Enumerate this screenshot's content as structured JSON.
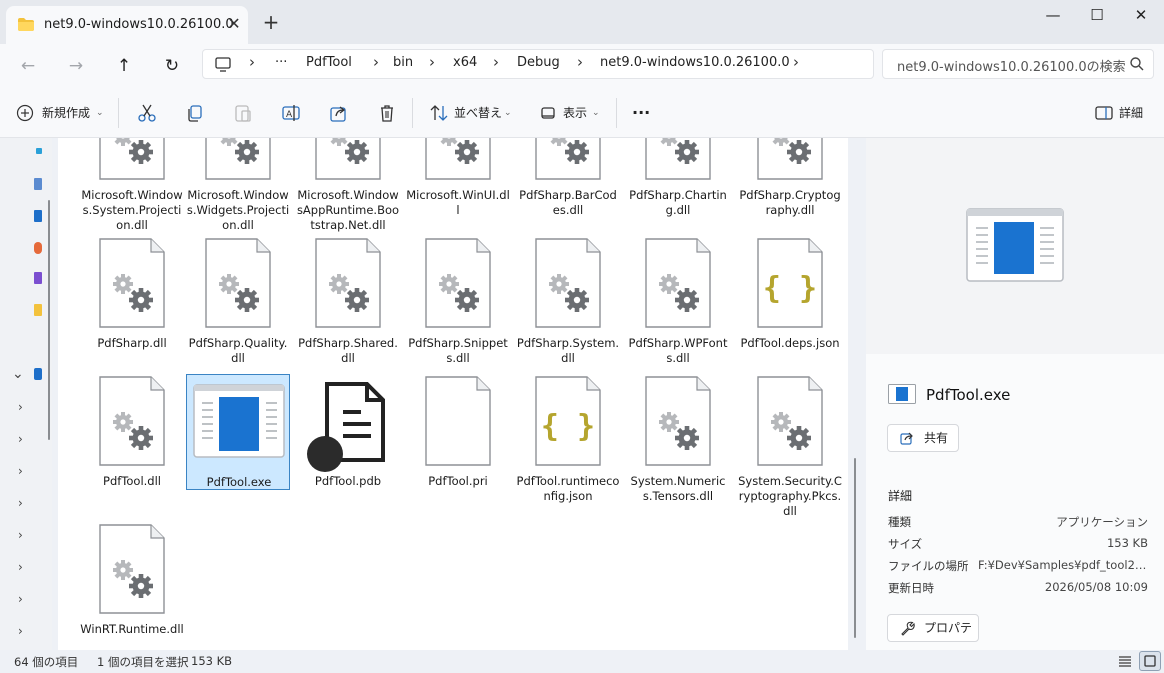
{
  "window": {
    "tab_title": "net9.0-windows10.0.26100.0",
    "close_tab": "✕",
    "new_tab": "+",
    "minimize": "—",
    "maximize": "☐",
    "close": "✕"
  },
  "nav": {
    "back": "←",
    "forward": "→",
    "up": "↑",
    "refresh": "↻",
    "breadcrumb": [
      "PdfTool",
      "bin",
      "x64",
      "Debug",
      "net9.0-windows10.0.26100.0"
    ],
    "more": "···",
    "search_placeholder": "net9.0-windows10.0.26100.0の検索"
  },
  "toolbar": {
    "new_label": "新規作成",
    "sort_label": "並べ替え",
    "view_label": "表示",
    "more_label": "···",
    "details_label": "詳細"
  },
  "files": [
    {
      "name": "Microsoft.Windows.System.Projection.dll",
      "icon": "dll-gear-icon"
    },
    {
      "name": "Microsoft.Windows.Widgets.Projection.dll",
      "icon": "dll-gear-icon"
    },
    {
      "name": "Microsoft.WindowsAppRuntime.Bootstrap.Net.dll",
      "icon": "dll-gear-icon"
    },
    {
      "name": "Microsoft.WinUI.dll",
      "icon": "dll-gear-icon"
    },
    {
      "name": "PdfSharp.BarCodes.dll",
      "icon": "dll-gear-icon"
    },
    {
      "name": "PdfSharp.Charting.dll",
      "icon": "dll-gear-icon"
    },
    {
      "name": "PdfSharp.Cryptography.dll",
      "icon": "dll-gear-icon"
    },
    {
      "name": "PdfSharp.dll",
      "icon": "dll-gear-icon"
    },
    {
      "name": "PdfSharp.Quality.dll",
      "icon": "dll-gear-icon"
    },
    {
      "name": "PdfSharp.Shared.dll",
      "icon": "dll-gear-icon"
    },
    {
      "name": "PdfSharp.Snippets.dll",
      "icon": "dll-gear-icon"
    },
    {
      "name": "PdfSharp.System.dll",
      "icon": "dll-gear-icon"
    },
    {
      "name": "PdfSharp.WPFonts.dll",
      "icon": "dll-gear-icon"
    },
    {
      "name": "PdfTool.deps.json",
      "icon": "json-braces-icon"
    },
    {
      "name": "PdfTool.dll",
      "icon": "dll-gear-icon"
    },
    {
      "name": "PdfTool.exe",
      "icon": "exe-window-icon"
    },
    {
      "name": "PdfTool.pdb",
      "icon": "pdb-document-icon"
    },
    {
      "name": "PdfTool.pri",
      "icon": "blank-file-icon"
    },
    {
      "name": "PdfTool.runtimeconfig.json",
      "icon": "json-braces-icon"
    },
    {
      "name": "System.Numerics.Tensors.dll",
      "icon": "dll-gear-icon"
    },
    {
      "name": "System.Security.Cryptography.Pkcs.dll",
      "icon": "dll-gear-icon"
    },
    {
      "name": "WinRT.Runtime.dll",
      "icon": "dll-gear-icon"
    }
  ],
  "details": {
    "name": "PdfTool.exe",
    "share_label": "共有",
    "section_title": "詳細",
    "props": [
      {
        "key": "種類",
        "value": "アプリケーション"
      },
      {
        "key": "サイズ",
        "value": "153 KB"
      },
      {
        "key": "ファイルの場所",
        "value": "F:¥Dev¥Samples¥pdf_tool2¥s..."
      },
      {
        "key": "更新日時",
        "value": "2026/05/08 10:09"
      }
    ],
    "properties_label": "プロパティ"
  },
  "status": {
    "count": "64 個の項目",
    "selected": "1 個の項目を選択",
    "size": "153 KB"
  },
  "colors": {
    "selection": "#cce8ff",
    "selection_border": "#3a84c4",
    "exe_blue": "#1a73d0",
    "json_yellow": "#b5a52e"
  }
}
